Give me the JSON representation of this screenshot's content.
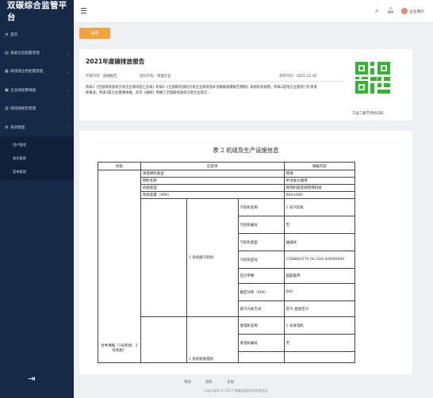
{
  "app": {
    "title": "双碳综合监管平台"
  },
  "sidebar": {
    "items": [
      {
        "label": "首页",
        "icon": "dashboard-icon"
      },
      {
        "label": "基础信息配置管理",
        "icon": "book-icon"
      },
      {
        "label": "碳排放边界配置管理",
        "icon": "boundary-icon"
      },
      {
        "label": "企业碳核算填报",
        "icon": "report-icon"
      },
      {
        "label": "碳排放报告管理",
        "icon": "file-icon"
      },
      {
        "label": "系统管理",
        "icon": "settings-icon"
      }
    ],
    "sub_items": [
      {
        "label": "用户管理"
      },
      {
        "label": "角色管理"
      },
      {
        "label": "菜单管理"
      }
    ]
  },
  "topbar": {
    "user_name": "企业用户"
  },
  "actions": {
    "export_label": "返回"
  },
  "report": {
    "title": "2021年度碳排放报告",
    "project_key": "所属项目：",
    "project_value": "排放报告",
    "org_key": "组织机构：",
    "org_value": "排放企业",
    "update_key": "更新时间：",
    "update_value": "2021.11.30",
    "desc_line1": "附表1《全国碳排放权交易企业碳排放汇总表》附表2《全国碳排放权交易企业碳排放补充数据核算报告模板》表格形式规则，附表2是地方主管部门负责发",
    "desc_line2": "委报送，附表3是企业需要填报。其次《通知》明确了全国碳排放权交易企业提交..."
  },
  "qr": {
    "caption": "工业二级节点标识码"
  },
  "doc": {
    "title": "表 2  机组及生产设施信息",
    "headers": [
      "机组",
      "信息项",
      "填报内容"
    ],
    "group_label": "合并填报（1号机组、2号机组）",
    "rows_simple": [
      {
        "label": "发电燃料类型",
        "value": "燃煤"
      },
      {
        "label": "燃料名称",
        "value": "中洋发分烟煤"
      },
      {
        "label": "机组类型",
        "value": "燃煤机组常规燃煤机组"
      },
      {
        "label": "装机容量（MW）",
        "value": "660+660"
      }
    ],
    "sub1_label": "1 号机组汽轮机",
    "sub1_rows": [
      {
        "label": "汽轮机名称",
        "value": "1 号汽轮机"
      },
      {
        "label": "汽轮机编号",
        "value": "无"
      },
      {
        "label": "汽轮机类型",
        "value": "抽凝式"
      },
      {
        "label": "汽轮机型号",
        "value": "CZK660/570-26.25/0.4//600/600"
      },
      {
        "label": "压力参数",
        "value": "超超临界"
      },
      {
        "label": "额定功率（MW）",
        "value": "660"
      },
      {
        "label": "排汽冷却方式",
        "value": "空冷-直接空冷"
      }
    ],
    "sub2_label": "1 号机组发电机",
    "sub2_rows": [
      {
        "label": "发电机名称",
        "value": "1 号发电机"
      },
      {
        "label": "发电机编号",
        "value": "无"
      }
    ]
  },
  "footer": {
    "links": [
      "帮助",
      "隐私",
      "条款"
    ],
    "copyright": "copyright © 2017 新能监服务技术部出品"
  }
}
